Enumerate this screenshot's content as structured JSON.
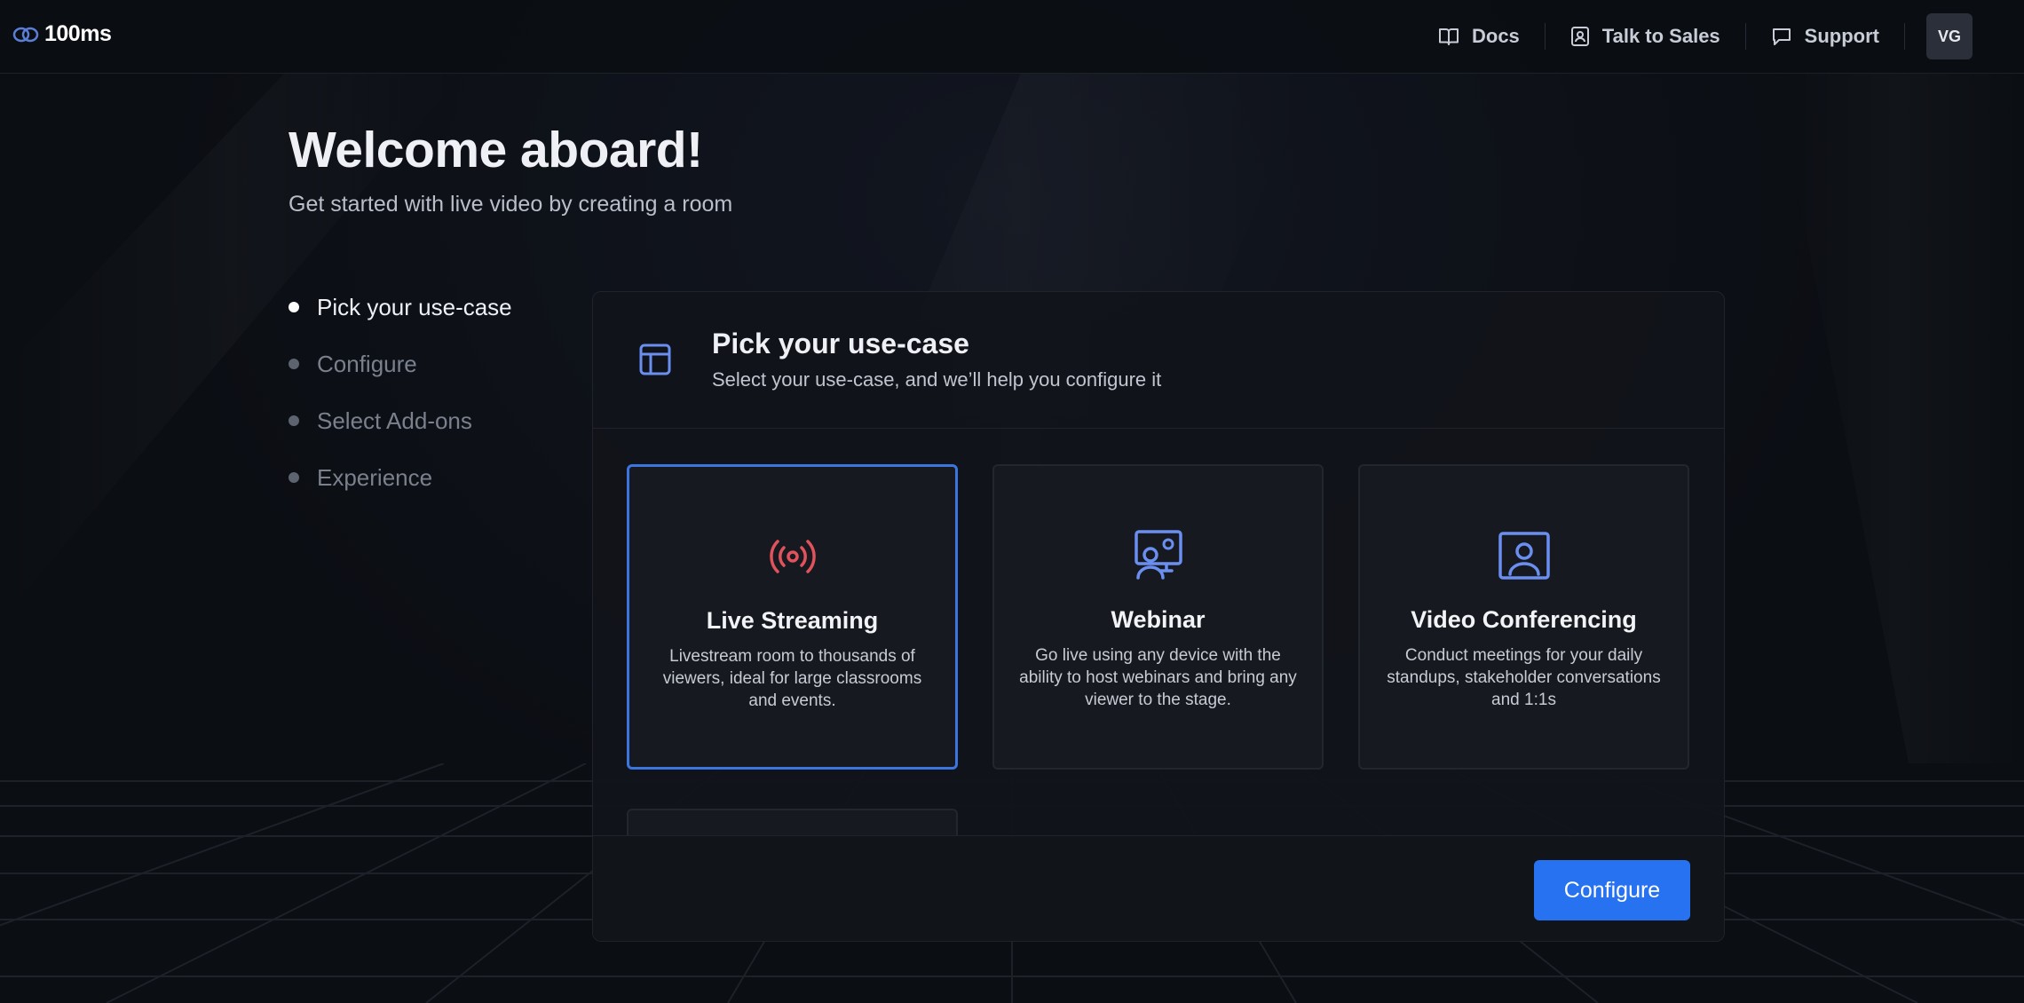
{
  "brand": {
    "name": "100ms"
  },
  "nav": {
    "docs": "Docs",
    "sales": "Talk to Sales",
    "support": "Support",
    "avatar_initials": "VG"
  },
  "hero": {
    "title": "Welcome aboard!",
    "subtitle": "Get started with live video by creating a room"
  },
  "steps": [
    {
      "label": "Pick your use-case",
      "active": true
    },
    {
      "label": "Configure",
      "active": false
    },
    {
      "label": "Select Add-ons",
      "active": false
    },
    {
      "label": "Experience",
      "active": false
    }
  ],
  "panel": {
    "title": "Pick your use-case",
    "subtitle": "Select your use-case, and we’ll help you configure it",
    "cards": [
      {
        "title": "Live Streaming",
        "description": "Livestream room to thousands of viewers, ideal for large classrooms and events.",
        "icon": "broadcast-icon",
        "selected": true
      },
      {
        "title": "Webinar",
        "description": "Go live using any device with the ability to host webinars and bring any viewer to the stage.",
        "icon": "presenter-icon",
        "selected": false
      },
      {
        "title": "Video Conferencing",
        "description": "Conduct meetings for your daily standups, stakeholder conversations and 1:1s",
        "icon": "video-user-icon",
        "selected": false
      }
    ],
    "configure_label": "Configure"
  },
  "colors": {
    "accent": "#2772f0",
    "selected_border": "#3a75e0",
    "live_icon": "#e0525c",
    "card_icon": "#6b8ff0"
  }
}
